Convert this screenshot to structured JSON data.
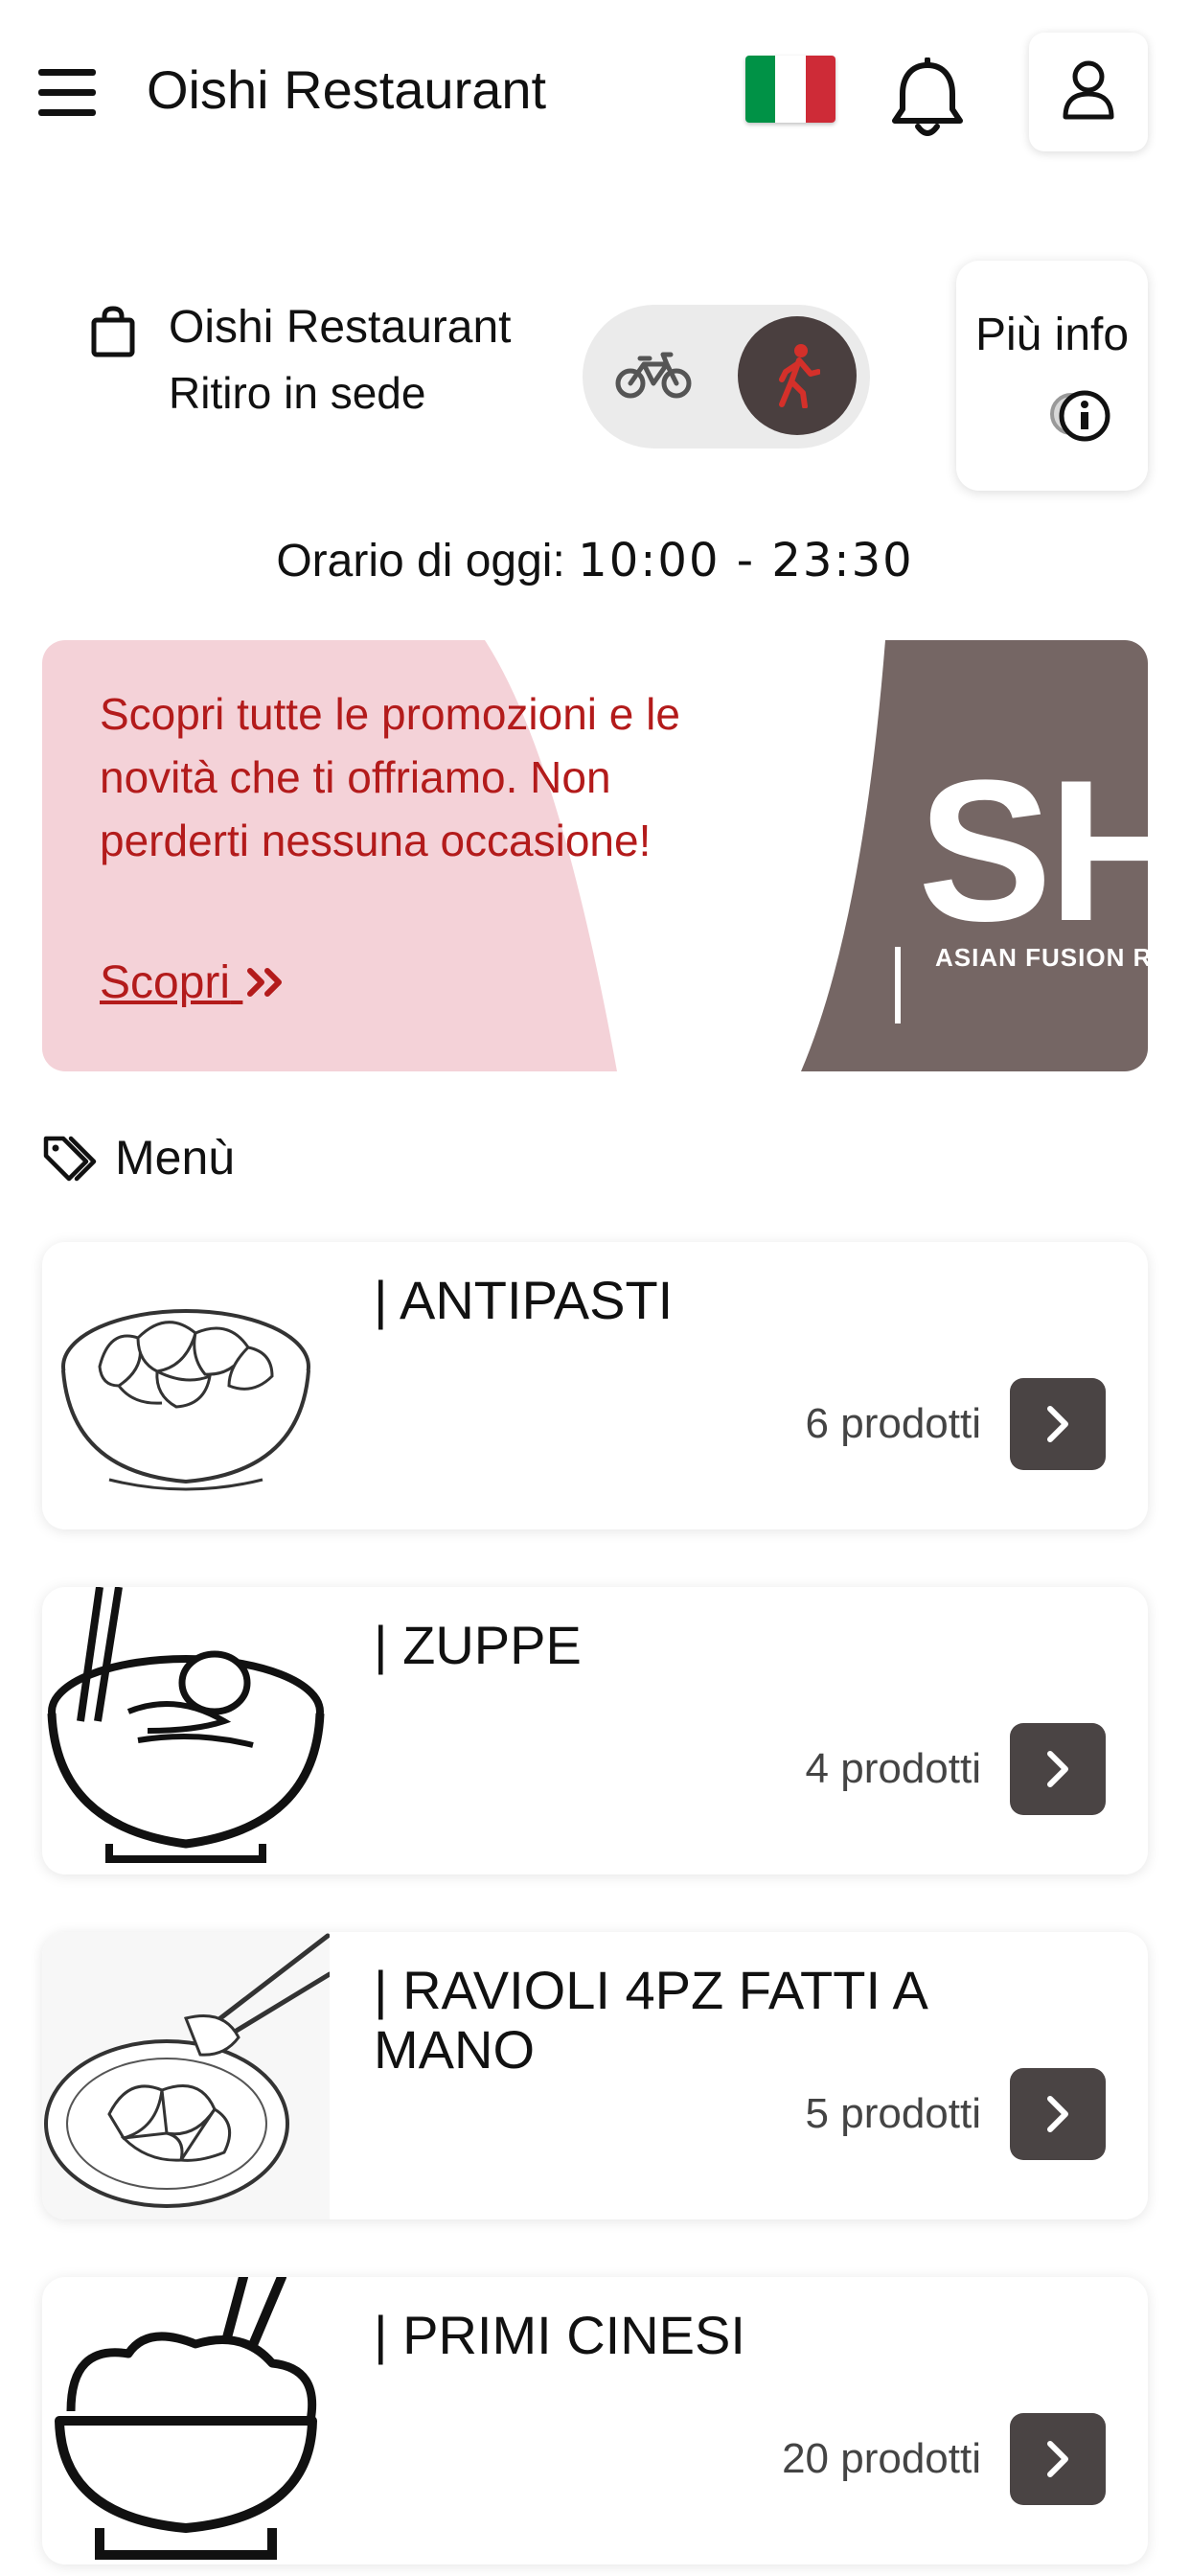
{
  "header": {
    "title": "Oishi Restaurant",
    "menu_icon": "hamburger-icon",
    "language_icon": "italy-flag-icon",
    "notification_icon": "bell-icon",
    "account_icon": "user-icon",
    "flag_colors": [
      "#009246",
      "#ffffff",
      "#ce2b37"
    ]
  },
  "store": {
    "name": "Oishi Restaurant",
    "mode": "Ritiro in sede",
    "bag_icon": "shopping-bag-icon",
    "delivery_options": [
      "bicycle-icon",
      "walking-person-icon"
    ],
    "selected_option": "walking-person-icon",
    "info_label": "Più info",
    "info_icon": "info-icon"
  },
  "hours": {
    "label": "Orario di oggi:",
    "value": "10:00 - 23:30"
  },
  "promo": {
    "text": "Scopri tutte le promozioni e le novità che ti offriamo. Non perderti nessuna occasione!",
    "link_label": "Scopri",
    "link_icon": "double-chevron-right-icon",
    "logo_text": "SH",
    "logo_subtext": "ASIAN FUSION RESTA",
    "colors": {
      "pink": "#f4d2d8",
      "brown": "#756664",
      "text": "#b31b1b"
    }
  },
  "menu": {
    "heading": "Menù",
    "heading_icon": "tags-icon",
    "categories": [
      {
        "title": "| ANTIPASTI",
        "count": "6 prodotti",
        "icon": "dumpling-bowl-icon"
      },
      {
        "title": "| ZUPPE",
        "count": "4 prodotti",
        "icon": "soup-bowl-icon"
      },
      {
        "title": "| RAVIOLI 4PZ FATTI A MANO",
        "count": "5 prodotti",
        "icon": "ravioli-plate-icon"
      },
      {
        "title": "| PRIMI CINESI",
        "count": "20 prodotti",
        "icon": "rice-bowl-icon"
      }
    ]
  },
  "accent_color": "#4a4444"
}
